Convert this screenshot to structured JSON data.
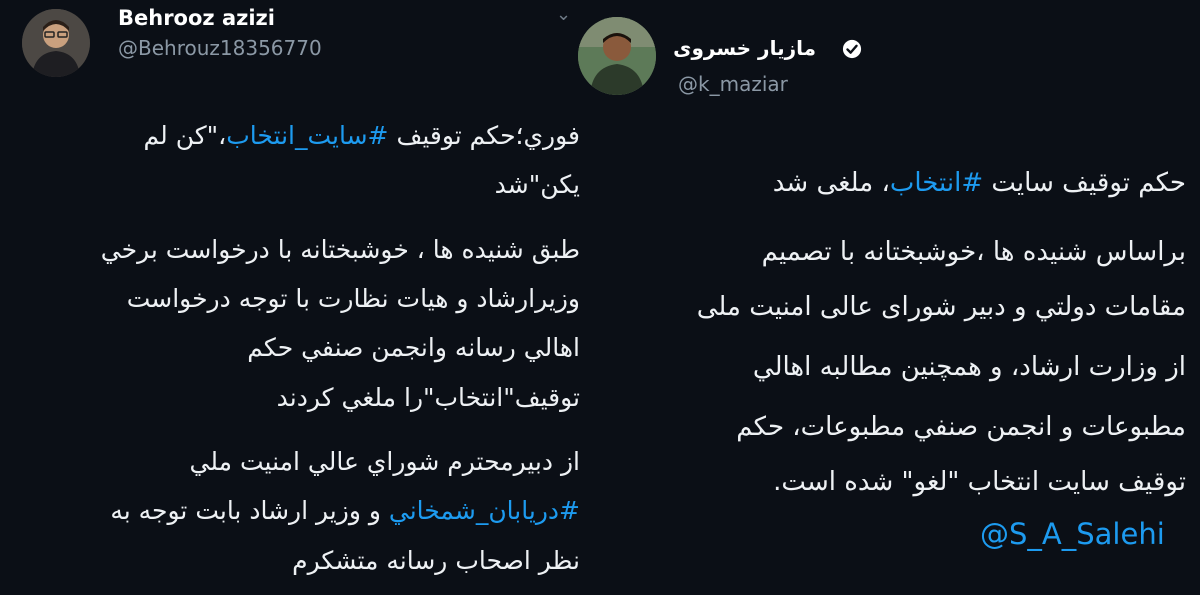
{
  "left_tweet": {
    "display_name": "Behrooz azizi",
    "handle": "@Behrouz18356770",
    "lines": [
      {
        "parts": [
          {
            "t": "فوري؛حكم توقيف "
          },
          {
            "t": "#سايت_انتخاب",
            "hashtag": true
          },
          {
            "t": "،\"كن لم"
          }
        ]
      },
      {
        "parts": [
          {
            "t": "يكن\"شد"
          }
        ]
      },
      {
        "parts": [
          {
            "t": "طبق شنيده ها ، خوشبختانه با درخواست برخي"
          }
        ]
      },
      {
        "parts": [
          {
            "t": "وزيرارشاد و هيات نظارت با توجه درخواست"
          }
        ]
      },
      {
        "parts": [
          {
            "t": "اهالي رسانه وانجمن صنفي حكم"
          }
        ]
      },
      {
        "parts": [
          {
            "t": "توقيف\"انتخاب\"را ملغي كردند"
          }
        ]
      },
      {
        "parts": [
          {
            "t": "از دبيرمحترم شوراي عالي امنيت ملي"
          }
        ]
      },
      {
        "parts": [
          {
            "t": "#دريابان_شمخاني",
            "hashtag": true
          },
          {
            "t": " و وزير ارشاد بابت توجه به"
          }
        ]
      },
      {
        "parts": [
          {
            "t": "نظر اصحاب رسانه متشكرم"
          }
        ]
      }
    ]
  },
  "right_tweet": {
    "display_name": "مازيار خسروى",
    "handle": "@k_maziar",
    "lines": [
      {
        "parts": [
          {
            "t": "حكم توقيف سايت "
          },
          {
            "t": "#انتخاب",
            "hashtag": true
          },
          {
            "t": "، ملغى شد"
          }
        ]
      },
      {
        "parts": [
          {
            "t": "براساس شنيده ها ،خوشبختانه با تصميم"
          }
        ]
      },
      {
        "parts": [
          {
            "t": "مقامات دولتي و دبير شوراى عالى امنيت ملى"
          }
        ]
      },
      {
        "parts": [
          {
            "t": "از وزارت ارشاد، و همچنين مطالبه اهالي"
          }
        ]
      },
      {
        "parts": [
          {
            "t": "مطبوعات و انجمن صنفي مطبوعات، حكم"
          }
        ]
      },
      {
        "parts": [
          {
            "t": "توقيف سايت انتخاب \"لغو\" شده است."
          }
        ]
      }
    ],
    "mention": "@S_A_Salehi"
  },
  "icons": {
    "menu_chevron": "chevron-down-icon",
    "verified_badge": "verified-badge-icon"
  },
  "colors": {
    "background": "#0b0f16",
    "text": "#eef1f4",
    "secondary": "#8b98a5",
    "accent": "#1d9bf0"
  }
}
